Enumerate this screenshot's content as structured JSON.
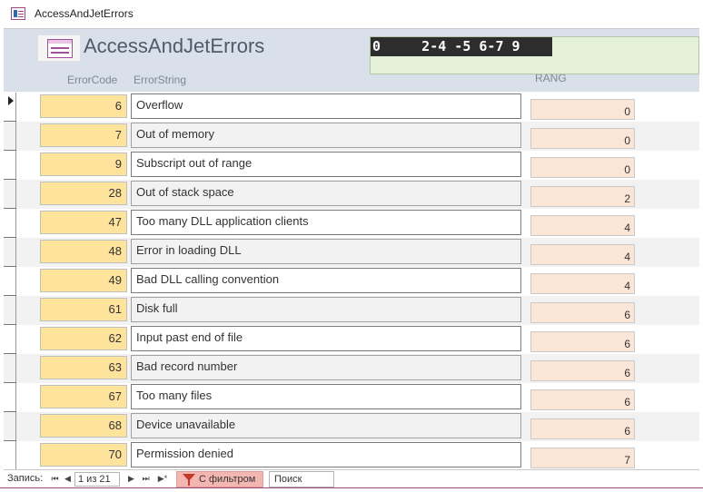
{
  "window": {
    "title": "AccessAndJetErrors"
  },
  "form": {
    "title": "AccessAndJetErrors",
    "labels": {
      "code": "ErrorCode",
      "string": "ErrorString",
      "rang": "RANG"
    },
    "display_strip": "0     2-4 -5 6-7 9"
  },
  "records": [
    {
      "code": "6",
      "string": "Overflow",
      "rang": "0"
    },
    {
      "code": "7",
      "string": "Out of memory",
      "rang": "0"
    },
    {
      "code": "9",
      "string": "Subscript out of range",
      "rang": "0"
    },
    {
      "code": "28",
      "string": "Out of stack space",
      "rang": "2"
    },
    {
      "code": "47",
      "string": "Too many DLL application clients",
      "rang": "4"
    },
    {
      "code": "48",
      "string": "Error in loading DLL",
      "rang": "4"
    },
    {
      "code": "49",
      "string": "Bad DLL calling convention",
      "rang": "4"
    },
    {
      "code": "61",
      "string": "Disk full",
      "rang": "6"
    },
    {
      "code": "62",
      "string": "Input past end of file",
      "rang": "6"
    },
    {
      "code": "63",
      "string": "Bad record number",
      "rang": "6"
    },
    {
      "code": "67",
      "string": "Too many files",
      "rang": "6"
    },
    {
      "code": "68",
      "string": "Device unavailable",
      "rang": "6"
    },
    {
      "code": "70",
      "string": "Permission denied",
      "rang": "7"
    }
  ],
  "navigation": {
    "label": "Запись:",
    "first": "⏮",
    "prev": "◀",
    "position": "1 из 21",
    "next": "▶",
    "last": "⏭",
    "new": "▶*",
    "filter_label": "С фильтром",
    "search_placeholder": "Поиск"
  },
  "icons": {
    "app": "form-icon",
    "filter": "filter-icon",
    "record_selector": "record-pointer-icon"
  },
  "colors": {
    "header_bg": "#d9e0ea",
    "code_field": "#fde39b",
    "rang_field": "#fbe5d6",
    "display_bg": "#e5f0da",
    "filter_bg": "#f4b6b0"
  }
}
